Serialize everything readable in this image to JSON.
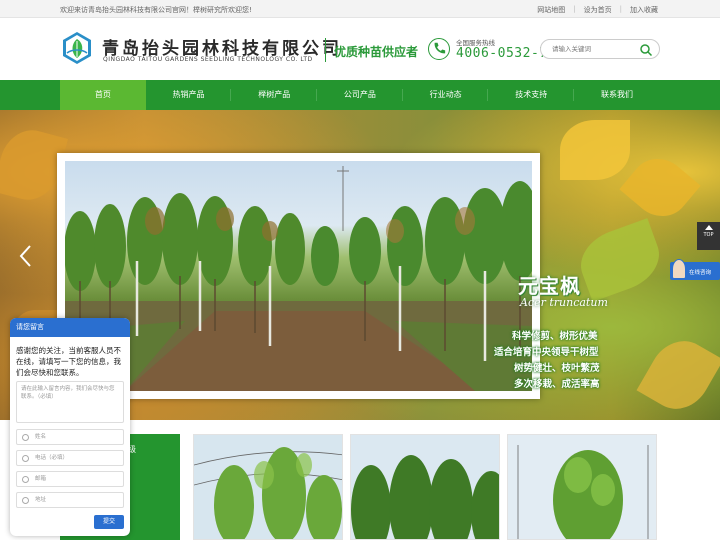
{
  "topbar": {
    "welcome": "欢迎来访青岛抬头园林科技有限公司官网！榉树研究所欢迎您!",
    "links": [
      "网站地图",
      "设为首页",
      "加入收藏"
    ]
  },
  "header": {
    "brand_cn": "青岛抬头园林科技有限公司",
    "brand_en": "QINGDAO TAITOU GARDENS SEEDLING TECHNOLOGY CO. LTD",
    "slogan": "优质种苗供应者",
    "hotline_label": "全国服务热线",
    "hotline_number": "4006-0532-71",
    "search_placeholder": "请输入关键词"
  },
  "nav": {
    "items": [
      "首页",
      "热销产品",
      "榉树产品",
      "公司产品",
      "行业动态",
      "技术支持",
      "联系我们"
    ],
    "active": "首页"
  },
  "banner": {
    "species_cn": "元宝枫",
    "species_latin": "Acer truncatum",
    "features": [
      "科学修剪、树形优美",
      "适合培育中央领导干树型",
      "树势健壮、枝叶繁茂",
      "多次移栽、成活率高"
    ]
  },
  "floaters": {
    "top_label": "TOP",
    "online_label": "在线咨询"
  },
  "lower": {
    "box_label": "级"
  },
  "chat": {
    "title": "请您留言",
    "message": "感谢您的关注，当前客服人员不在线，请填写一下您的信息，我们会尽快和您联系。",
    "textarea_placeholder": "请在此输入留言内容，我们会尽快与您联系。（必填）",
    "fields": [
      "姓名",
      "电话（必填）",
      "邮箱",
      "地址"
    ],
    "submit": "提交"
  },
  "colors": {
    "brand_green": "#24952f",
    "active_nav": "#5bb832",
    "chat_blue": "#2a6fd0"
  }
}
